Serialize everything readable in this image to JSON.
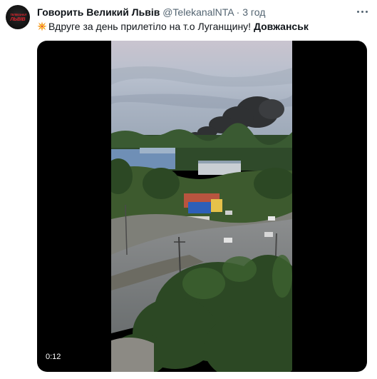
{
  "tweet": {
    "author_name": "Говорить Великий Львів",
    "handle": "@TelekanalNTA",
    "separator": "·",
    "time": "3 год",
    "text_plain": "Вдруге за день прилетіло на т.о Луганщину!",
    "text_bold": "Довжанськ"
  },
  "avatar": {
    "logo_top": "ТЕЛЕКАНАЛ",
    "logo_main": "ЛЬВІВ"
  },
  "media": {
    "duration": "0:12"
  },
  "colors": {
    "text": "#0f1419",
    "muted": "#536471",
    "logo_red": "#e0242c"
  },
  "icons": {
    "emoji": "collision-emoji-icon",
    "more": "more-dots-icon"
  }
}
